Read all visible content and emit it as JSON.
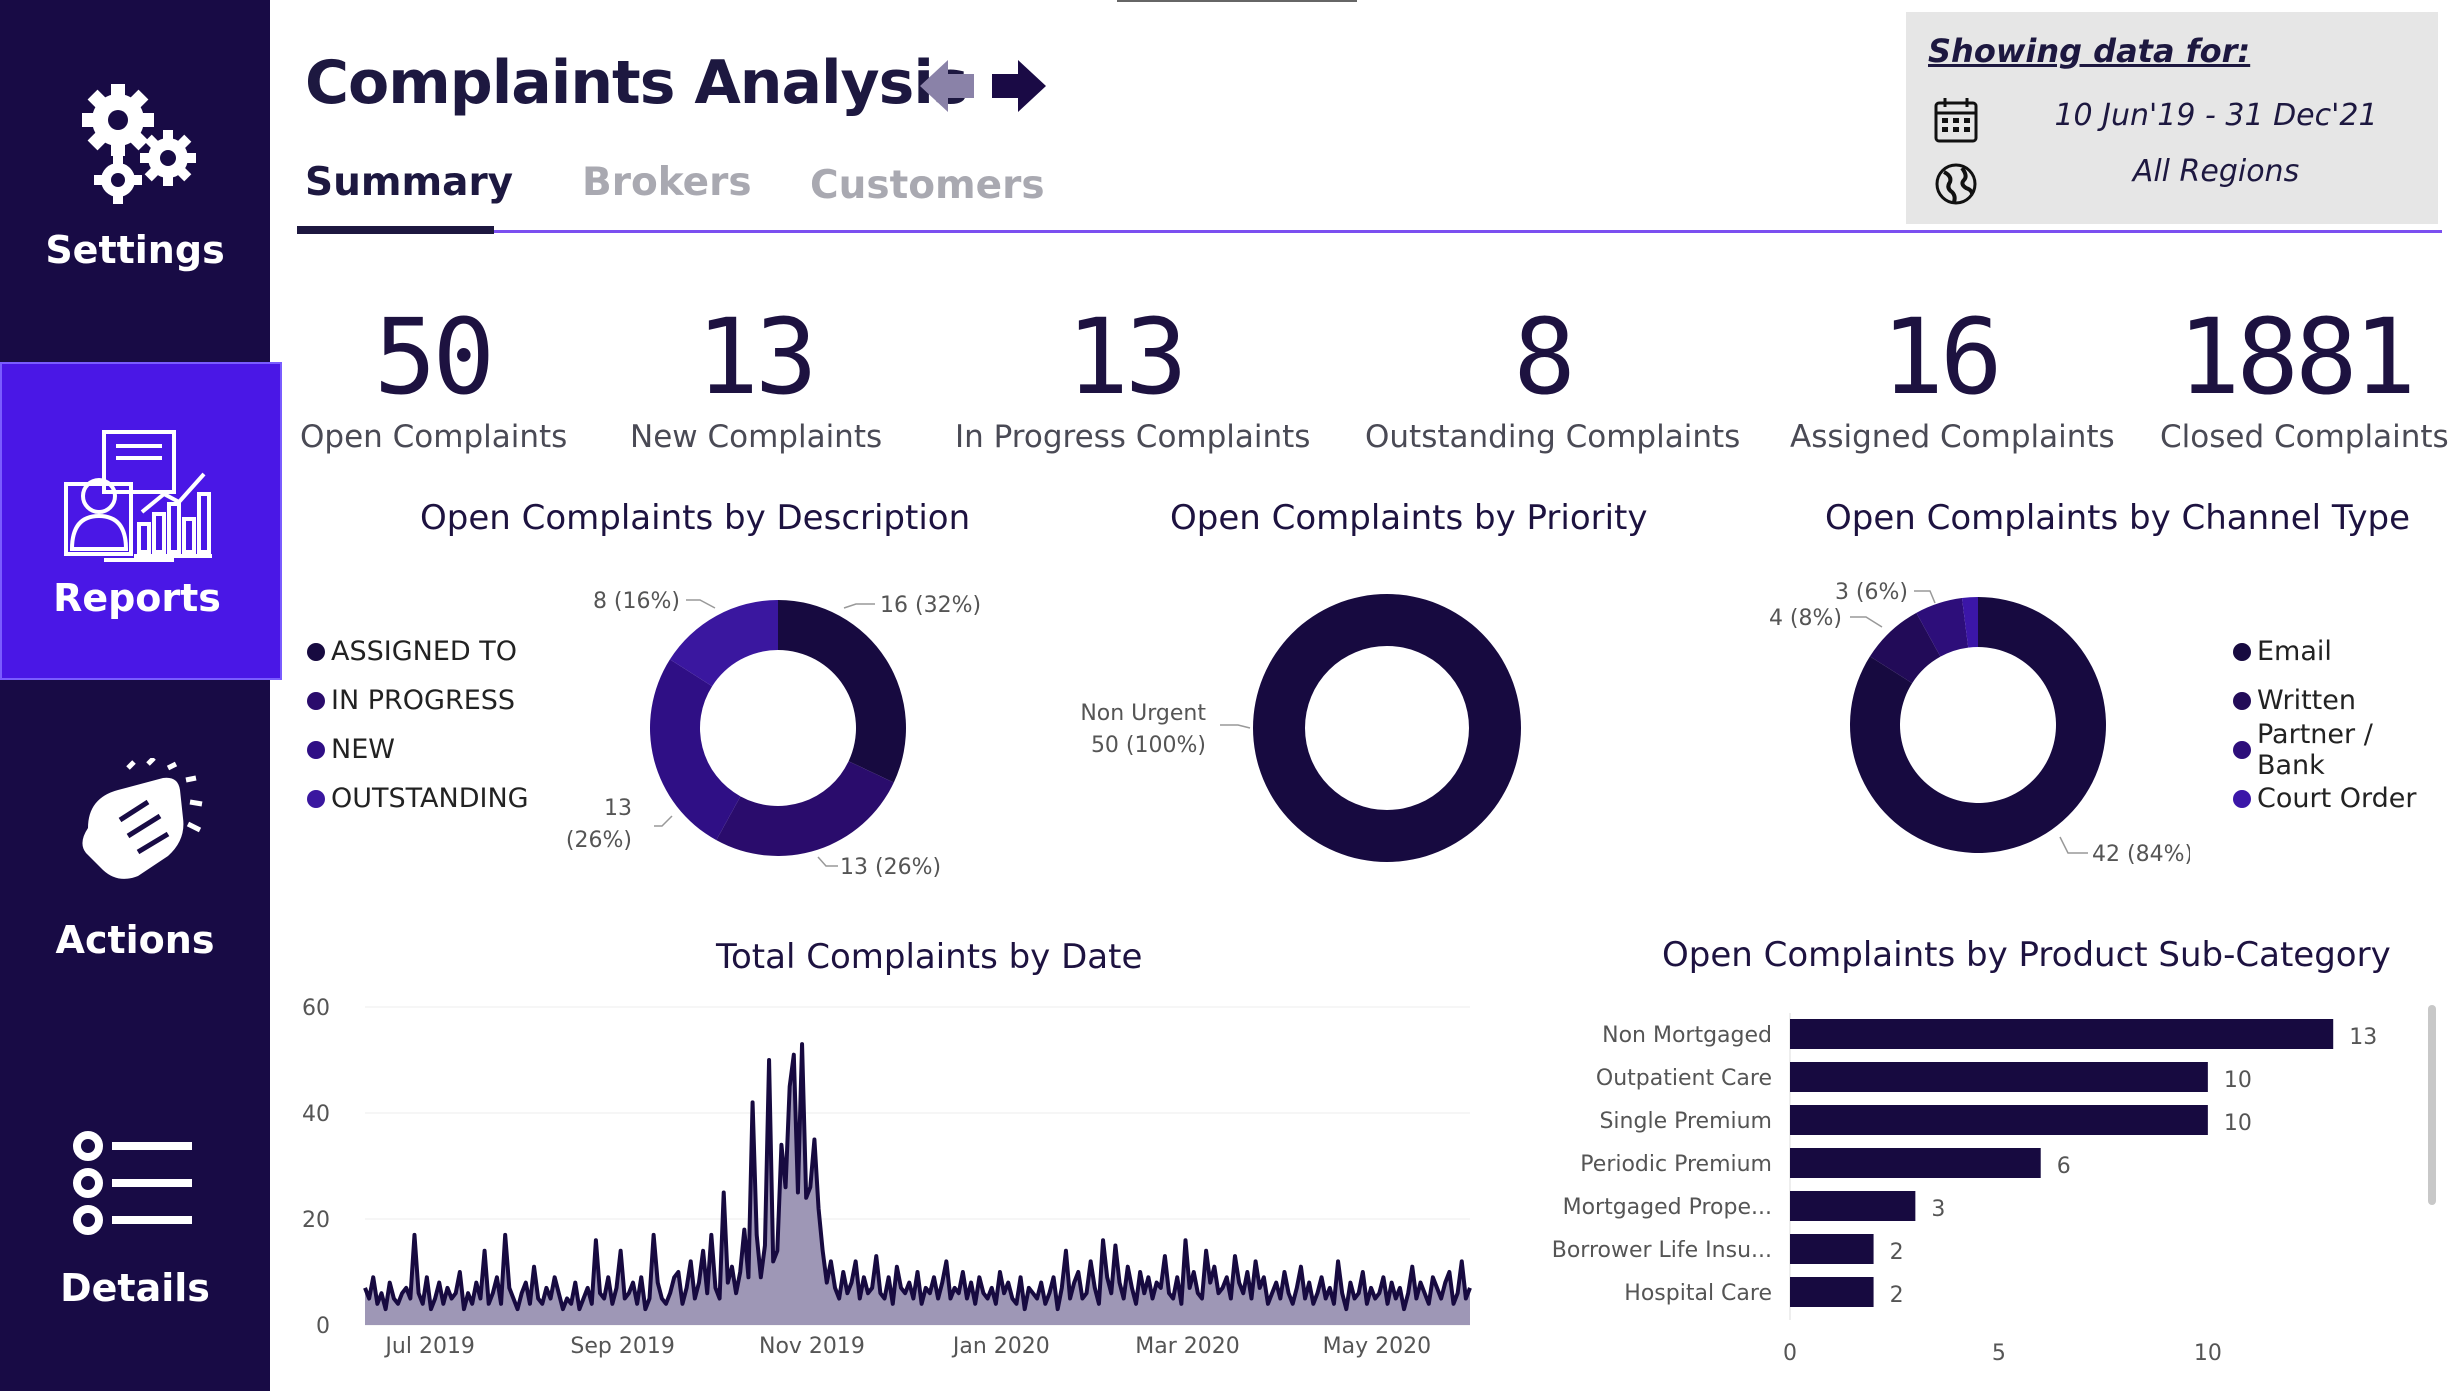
{
  "sidebar": {
    "items": [
      {
        "label": "Settings",
        "icon": "gears-icon"
      },
      {
        "label": "Reports",
        "icon": "report-icon",
        "active": true
      },
      {
        "label": "Actions",
        "icon": "hand-icon"
      },
      {
        "label": "Details",
        "icon": "list-icon"
      }
    ]
  },
  "header": {
    "title": "Complaints Analysis",
    "tabs": [
      {
        "label": "Summary",
        "active": true
      },
      {
        "label": "Brokers"
      },
      {
        "label": "Customers"
      }
    ]
  },
  "filters": {
    "heading": "Showing data for:",
    "date_range": "10 Jun'19 - 31 Dec'21",
    "region": "All Regions"
  },
  "kpis": [
    {
      "value": "50",
      "label": "Open Complaints"
    },
    {
      "value": "13",
      "label": "New Complaints"
    },
    {
      "value": "13",
      "label": "In Progress Complaints"
    },
    {
      "value": "8",
      "label": "Outstanding Complaints"
    },
    {
      "value": "16",
      "label": "Assigned Complaints"
    },
    {
      "value": "1881",
      "label": "Closed Complaints"
    }
  ],
  "colors": {
    "dark": "#1a0a45",
    "purple": "#2e0d7a",
    "violet": "#3b16a8",
    "area": "#9e97b6",
    "accent": "#4a17e6"
  },
  "chart_data": [
    {
      "type": "pie",
      "title": "Open Complaints by Description",
      "legend": [
        "ASSIGNED TO",
        "IN PROGRESS",
        "NEW",
        "OUTSTANDING"
      ],
      "slices": [
        {
          "name": "ASSIGNED TO",
          "value": 16,
          "label": "16 (32%)",
          "color": "#170a40"
        },
        {
          "name": "IN PROGRESS",
          "value": 13,
          "label": "13 (26%)",
          "color": "#2a0c6c"
        },
        {
          "name": "NEW",
          "value": 13,
          "label_a": "13",
          "label_b": "(26%)",
          "color": "#2f0f85"
        },
        {
          "name": "OUTSTANDING",
          "value": 8,
          "label": "8 (16%)",
          "color": "#3a179f"
        }
      ]
    },
    {
      "type": "pie",
      "title": "Open Complaints by Priority",
      "slices": [
        {
          "name": "Non Urgent",
          "value": 50,
          "label_a": "Non Urgent",
          "label_b": "50 (100%)",
          "color": "#170a40"
        }
      ]
    },
    {
      "type": "pie",
      "title": "Open Complaints by Channel Type",
      "legend": [
        "Email",
        "Written",
        "Partner / Bank",
        "Court Order"
      ],
      "slices": [
        {
          "name": "Email",
          "value": 42,
          "label": "42 (84%)",
          "color": "#170a40"
        },
        {
          "name": "Written",
          "value": 4,
          "label": "4 (8%)",
          "color": "#220b58"
        },
        {
          "name": "Partner / Bank",
          "value": 3,
          "label": "3 (6%)",
          "color": "#2d0e7a"
        },
        {
          "name": "Court Order",
          "value": 1,
          "label": "",
          "color": "#3b16a8"
        }
      ]
    },
    {
      "type": "area",
      "title": "Total Complaints by Date",
      "x_range": [
        "2019-06-10",
        "2020-05-31"
      ],
      "x_ticks": [
        "Jul 2019",
        "Sep 2019",
        "Nov 2019",
        "Jan 2020",
        "Mar 2020",
        "May 2020"
      ],
      "y_ticks": [
        "0",
        "20",
        "40",
        "60"
      ],
      "ylim": [
        0,
        60
      ],
      "values": [
        7,
        5,
        9,
        4,
        6,
        3,
        8,
        5,
        4,
        6,
        7,
        5,
        17,
        6,
        4,
        9,
        3,
        5,
        8,
        4,
        7,
        5,
        6,
        10,
        3,
        6,
        4,
        8,
        5,
        14,
        4,
        6,
        9,
        4,
        17,
        7,
        5,
        3,
        6,
        8,
        4,
        11,
        5,
        4,
        7,
        5,
        9,
        6,
        3,
        5,
        4,
        8,
        3,
        5,
        7,
        4,
        16,
        6,
        5,
        9,
        4,
        7,
        14,
        5,
        6,
        8,
        4,
        9,
        3,
        5,
        17,
        8,
        5,
        4,
        6,
        9,
        10,
        4,
        7,
        12,
        5,
        8,
        14,
        6,
        17,
        7,
        5,
        25,
        8,
        11,
        6,
        10,
        18,
        9,
        42,
        17,
        9,
        15,
        50,
        12,
        14,
        34,
        26,
        45,
        51,
        25,
        53,
        24,
        26,
        35,
        22,
        14,
        8,
        12,
        7,
        5,
        10,
        6,
        8,
        12,
        5,
        9,
        6,
        7,
        13,
        6,
        5,
        9,
        4,
        11,
        7,
        6,
        8,
        5,
        10,
        4,
        7,
        6,
        9,
        5,
        8,
        12,
        5,
        7,
        6,
        10,
        5,
        8,
        4,
        9,
        6,
        5,
        7,
        4,
        10,
        6,
        8,
        5,
        4,
        9,
        3,
        7,
        6,
        5,
        8,
        4,
        6,
        9,
        3,
        7,
        14,
        5,
        8,
        10,
        5,
        6,
        12,
        7,
        4,
        16,
        9,
        6,
        15,
        8,
        5,
        11,
        7,
        4,
        10,
        6,
        9,
        5,
        8,
        7,
        13,
        6,
        5,
        9,
        4,
        16,
        7,
        10,
        6,
        5,
        14,
        8,
        11,
        6,
        7,
        9,
        5,
        13,
        8,
        6,
        10,
        5,
        12,
        7,
        9,
        4,
        6,
        8,
        5,
        10,
        6,
        4,
        7,
        11,
        5,
        8,
        4,
        6,
        9,
        5,
        7,
        4,
        12,
        6,
        3,
        8,
        5,
        6,
        10,
        4,
        7,
        5,
        6,
        9,
        4,
        8,
        5,
        7,
        3,
        6,
        11,
        5,
        8,
        6,
        4,
        9,
        7,
        5,
        8,
        10,
        4,
        6,
        12,
        5,
        7
      ]
    },
    {
      "type": "bar",
      "title": "Open Complaints by Product Sub-Category",
      "categories": [
        "Non Mortgaged",
        "Outpatient Care",
        "Single Premium",
        "Periodic Premium",
        "Mortgaged Prope...",
        "Borrower Life Insu...",
        "Hospital Care"
      ],
      "values": [
        13,
        10,
        10,
        6,
        3,
        2,
        2
      ],
      "x_ticks": [
        "0",
        "5",
        "10"
      ],
      "xlim": [
        0,
        14
      ]
    }
  ]
}
